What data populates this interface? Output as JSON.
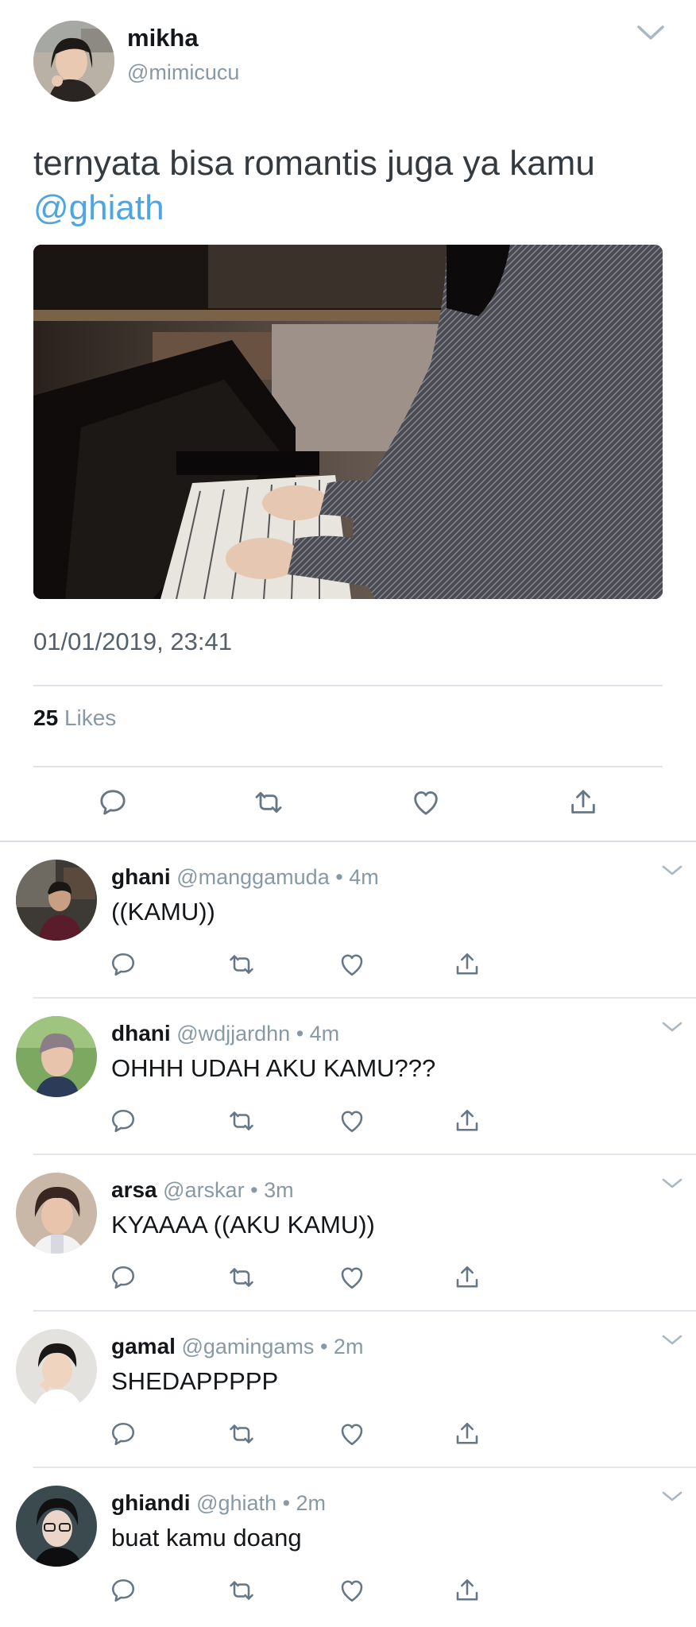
{
  "tweet": {
    "author_name": "mikha",
    "author_handle": "@mimicucu",
    "text": "ternyata bisa romantis juga ya kamu",
    "mention": "@ghiath",
    "timestamp": "01/01/2019, 23:41",
    "likes_count": "25",
    "likes_label": "Likes"
  },
  "icons": {
    "reply": "reply-icon",
    "retweet": "retweet-icon",
    "like": "heart-icon",
    "share": "share-icon",
    "more": "chevron-down-icon"
  },
  "colors": {
    "mention": "#4da5e3",
    "secondary_text": "#8899a6",
    "icon": "#657786"
  },
  "replies": [
    {
      "name": "ghani",
      "handle": "@manggamuda",
      "time": "4m",
      "text": "((KAMU))"
    },
    {
      "name": "dhani",
      "handle": "@wdjjardhn",
      "time": "4m",
      "text": "OHHH UDAH AKU KAMU???"
    },
    {
      "name": "arsa",
      "handle": "@arskar",
      "time": "3m",
      "text": "KYAAAA ((AKU KAMU))"
    },
    {
      "name": "gamal",
      "handle": "@gamingams",
      "time": "2m",
      "text": "SHEDAPPPPP"
    },
    {
      "name": "ghiandi",
      "handle": "@ghiath",
      "time": "2m",
      "text": "buat kamu doang"
    }
  ]
}
